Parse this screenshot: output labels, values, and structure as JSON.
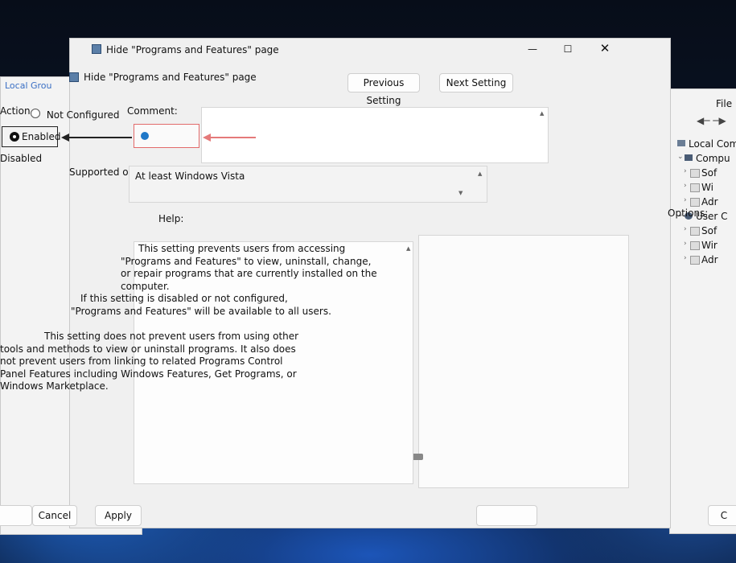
{
  "main_window": {
    "title": "Hide \"Programs and Features\" page",
    "header_title": "Hide \"Programs and Features\" page",
    "previous_setting": "Previous Setting",
    "next_setting": "Next Setting",
    "comment_label": "Comment:",
    "supported_label": "Supported on:",
    "supported_value": "At least Windows Vista",
    "options_label": "Options:",
    "help_label": "Help:",
    "help_paragraphs": [
      "This setting prevents users from accessing \"Programs and Features\" to view, uninstall, change, or repair programs that are currently installed on the computer.",
      "If this setting is disabled or not configured, \"Programs and Features\" will be available to all users.",
      "This setting does not prevent users from using other tools and methods to view or uninstall programs. It also does not prevent users from linking to related Programs Control Panel Features including Windows Features, Get Programs, or Windows Marketplace."
    ]
  },
  "left_panel": {
    "local_group": "Local Grou",
    "action_label": "Action",
    "not_configured": "Not Configured",
    "enabled": "Enabled",
    "disabled": "Disabled",
    "ok_label": "",
    "cancel_label": "Cancel",
    "apply_label": "Apply"
  },
  "right_panel": {
    "file_label": "File",
    "tree": [
      {
        "label": "Local Comp",
        "indent": 0
      },
      {
        "label": "Compu",
        "indent": 1
      },
      {
        "label": "Sof",
        "indent": 2
      },
      {
        "label": "Wi",
        "indent": 2
      },
      {
        "label": "Adr",
        "indent": 2
      },
      {
        "label": "User C",
        "indent": 1
      },
      {
        "label": "Sof",
        "indent": 2
      },
      {
        "label": "Wir",
        "indent": 2
      },
      {
        "label": "Adr",
        "indent": 2
      }
    ],
    "ok_label": "C"
  }
}
